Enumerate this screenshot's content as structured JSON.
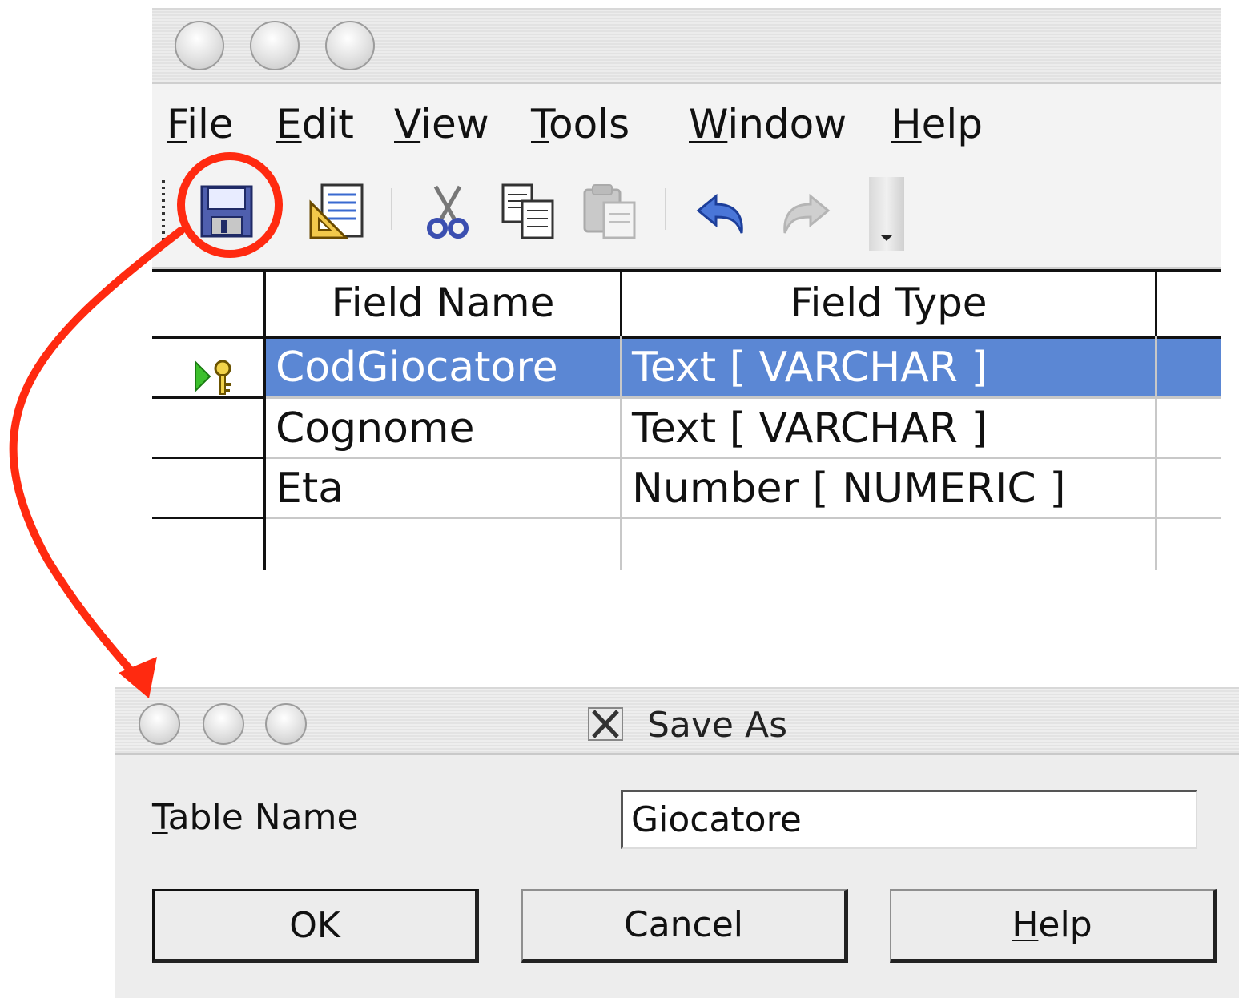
{
  "main_window": {
    "menu": [
      {
        "label": "File",
        "mnemonic": "F",
        "rest": "ile"
      },
      {
        "label": "Edit",
        "mnemonic": "E",
        "rest": "dit"
      },
      {
        "label": "View",
        "mnemonic": "V",
        "rest": "iew"
      },
      {
        "label": "Tools",
        "mnemonic": "T",
        "rest": "ools"
      },
      {
        "label": "Window",
        "mnemonic": "W",
        "rest": "indow"
      },
      {
        "label": "Help",
        "mnemonic": "H",
        "rest": "elp"
      }
    ],
    "toolbar": {
      "buttons": [
        "save-icon",
        "edit-document-icon",
        "cut-icon",
        "copy-icon",
        "paste-icon",
        "undo-icon",
        "redo-icon"
      ]
    },
    "table": {
      "headers": [
        "Field Name",
        "Field Type"
      ],
      "rows": [
        {
          "name": "CodGiocatore",
          "type": "Text [ VARCHAR ]",
          "selected": true,
          "primary_key": true
        },
        {
          "name": "Cognome",
          "type": "Text [ VARCHAR ]",
          "selected": false,
          "primary_key": false
        },
        {
          "name": "Eta",
          "type": "Number [ NUMERIC ]",
          "selected": false,
          "primary_key": false
        },
        {
          "name": "",
          "type": "",
          "selected": false,
          "primary_key": false
        }
      ]
    }
  },
  "dialog": {
    "title": "Save As",
    "table_name_label": {
      "mnemonic": "T",
      "rest": "able Name"
    },
    "table_name_value": "Giocatore",
    "buttons": {
      "ok": "OK",
      "cancel": "Cancel",
      "help": {
        "mnemonic": "H",
        "rest": "elp"
      }
    }
  },
  "colors": {
    "selection": "#5b87d4",
    "annotation": "#ff2a10",
    "window_bg": "#f3f3f3"
  }
}
